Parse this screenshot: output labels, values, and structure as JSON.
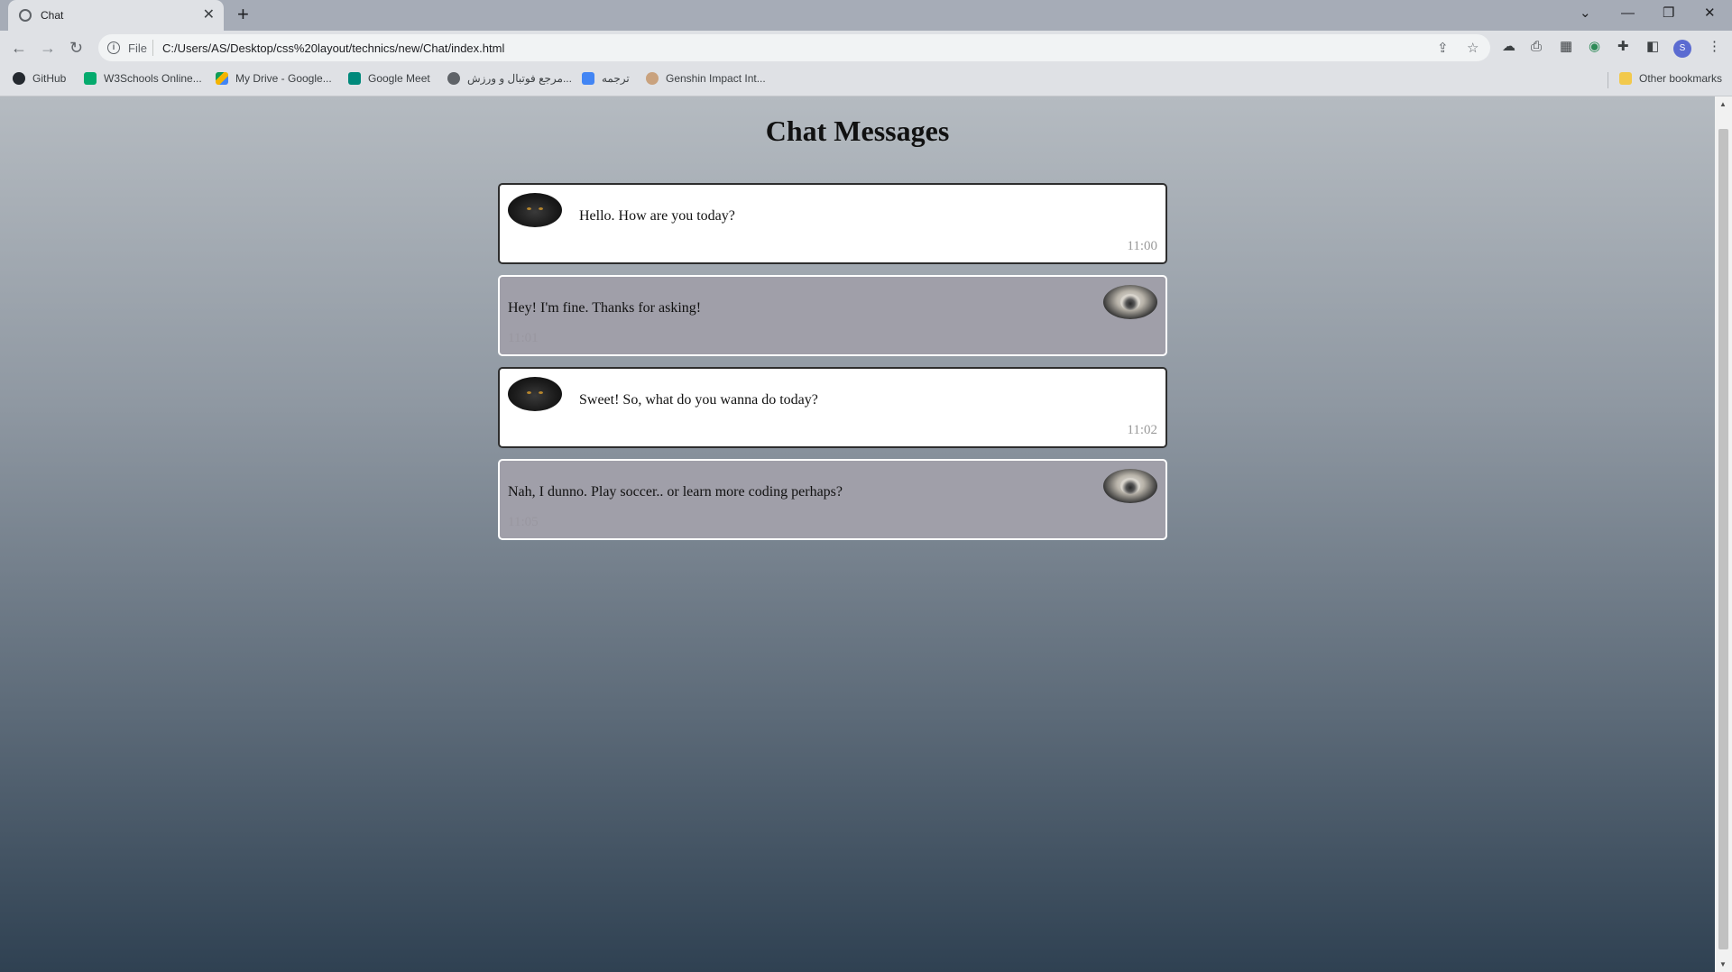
{
  "browser": {
    "tab": {
      "title": "Chat",
      "close": "✕"
    },
    "new_tab": "+",
    "window_controls": {
      "dropdown": "⌄",
      "minimize": "—",
      "restore": "❐",
      "close": "✕"
    },
    "nav": {
      "back": "←",
      "forward": "→",
      "reload": "↻"
    },
    "address": {
      "scheme_label": "File",
      "url": "C:/Users/AS/Desktop/css%20layout/technics/new/Chat/index.html"
    },
    "profile_initial": "S",
    "bookmarks": [
      {
        "label": "GitHub",
        "icon": "github-icon",
        "color": "#24292f"
      },
      {
        "label": "W3Schools Online...",
        "icon": "w3schools-icon",
        "color": "#04aa6d"
      },
      {
        "label": "My Drive - Google...",
        "icon": "google-drive-icon",
        "color": "#f4b400"
      },
      {
        "label": "Google Meet",
        "icon": "google-meet-icon",
        "color": "#00897b"
      },
      {
        "label": "مرجع فوتبال و ورزش...",
        "icon": "football-site-icon",
        "color": "#5f6368"
      },
      {
        "label": "ترجمه",
        "icon": "google-translate-icon",
        "color": "#4285f4"
      },
      {
        "label": "Genshin Impact Int...",
        "icon": "genshin-icon",
        "color": "#c9a27e"
      }
    ],
    "other_bookmarks": "Other bookmarks"
  },
  "page": {
    "title": "Chat Messages",
    "messages": [
      {
        "sender": "cat-user",
        "text": "Hello. How are you today?",
        "time": "11:00"
      },
      {
        "sender": "pug-user",
        "text": "Hey! I'm fine. Thanks for asking!",
        "time": "11:01"
      },
      {
        "sender": "cat-user",
        "text": "Sweet! So, what do you wanna do today?",
        "time": "11:02"
      },
      {
        "sender": "pug-user",
        "text": "Nah, I dunno. Play soccer.. or learn more coding perhaps?",
        "time": "11:05"
      }
    ]
  },
  "colors": {
    "own_message_bg": "#ffffff",
    "reply_message_bg": "#a09fa9",
    "gradient_top": "#b5bbc1",
    "gradient_bottom": "#2f4152"
  }
}
